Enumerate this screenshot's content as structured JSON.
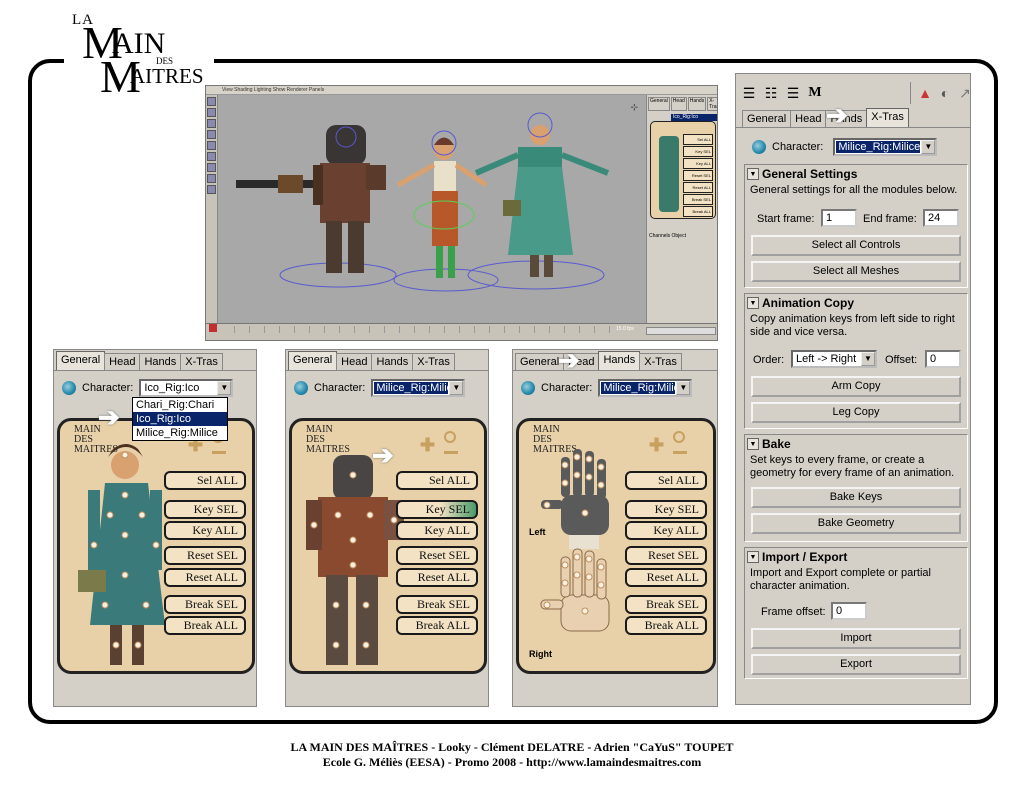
{
  "logo": {
    "la": "LA",
    "m1": "M",
    "ain": "AIN",
    "des": "DES",
    "m2": "M",
    "aitres": "AITRES"
  },
  "viewport": {
    "menu": "View   Shading   Lighting   Show   Renderer   Panels",
    "side_tabs": [
      "General",
      "Head",
      "Hands",
      "X-Tras"
    ],
    "side_combo": "Ico_Rig:Ico",
    "side_buttons": [
      "Sel ALL",
      "Key SEL",
      "Key ALL",
      "Reset SEL",
      "Reset ALL",
      "Break SEL",
      "Break ALL"
    ],
    "channels_label": "Channels   Object",
    "fps": "15.0 fps"
  },
  "panels": [
    {
      "tabs": [
        "General",
        "Head",
        "Hands",
        "X-Tras"
      ],
      "active_tab": 0,
      "character_label": "Character:",
      "character_value": "Ico_Rig:Ico",
      "dropdown_options": [
        "Chari_Rig:Chari",
        "Ico_Rig:Ico",
        "Milice_Rig:Milice"
      ],
      "dropdown_selected": 1,
      "logo_text": "MAIN DES MAITRES",
      "buttons": [
        "Sel ALL",
        "Key SEL",
        "Key ALL",
        "Reset SEL",
        "Reset ALL",
        "Break SEL",
        "Break ALL"
      ]
    },
    {
      "tabs": [
        "General",
        "Head",
        "Hands",
        "X-Tras"
      ],
      "active_tab": 0,
      "character_label": "Character:",
      "character_value": "Milice_Rig:Milice",
      "logo_text": "MAIN DES MAITRES",
      "buttons": [
        "Sel ALL",
        "Key SEL",
        "Key ALL",
        "Reset SEL",
        "Reset ALL",
        "Break SEL",
        "Break ALL"
      ],
      "highlighted": 1
    },
    {
      "tabs": [
        "General",
        "Head",
        "Hands",
        "X-Tras"
      ],
      "active_tab": 2,
      "character_label": "Character:",
      "character_value": "Milice_Rig:Milice",
      "logo_text": "MAIN DES MAITRES",
      "hand_labels": [
        "Left",
        "Right"
      ],
      "buttons": [
        "Sel ALL",
        "Key SEL",
        "Key ALL",
        "Reset SEL",
        "Reset ALL",
        "Break SEL",
        "Break ALL"
      ]
    }
  ],
  "xtras": {
    "tabs": [
      "General",
      "Head",
      "Hands",
      "X-Tras"
    ],
    "active_tab": 3,
    "character_label": "Character:",
    "character_value": "Milice_Rig:Milice",
    "general": {
      "title": "General Settings",
      "text": "General settings for all the modules below.",
      "start_label": "Start frame:",
      "start_value": "1",
      "end_label": "End frame:",
      "end_value": "24",
      "btn1": "Select all Controls",
      "btn2": "Select all Meshes"
    },
    "anim": {
      "title": "Animation Copy",
      "text": "Copy animation keys from left side to right side and vice versa.",
      "order_label": "Order:",
      "order_value": "Left -> Right",
      "offset_label": "Offset:",
      "offset_value": "0",
      "btn1": "Arm Copy",
      "btn2": "Leg Copy"
    },
    "bake": {
      "title": "Bake",
      "text": "Set keys to every frame, or create a geometry for every frame of an animation.",
      "btn1": "Bake Keys",
      "btn2": "Bake Geometry"
    },
    "io": {
      "title": "Import / Export",
      "text": "Import and Export complete or partial character animation.",
      "offset_label": "Frame offset:",
      "offset_value": "0",
      "btn1": "Import",
      "btn2": "Export"
    }
  },
  "footer": {
    "line1": "LA MAIN DES MAÎTRES - Looky - Clément DELATRE - Adrien \"CaYuS\" TOUPET",
    "line2": "Ecole G. Méliès (EESA) - Promo 2008 - http://www.lamaindesmaitres.com"
  }
}
